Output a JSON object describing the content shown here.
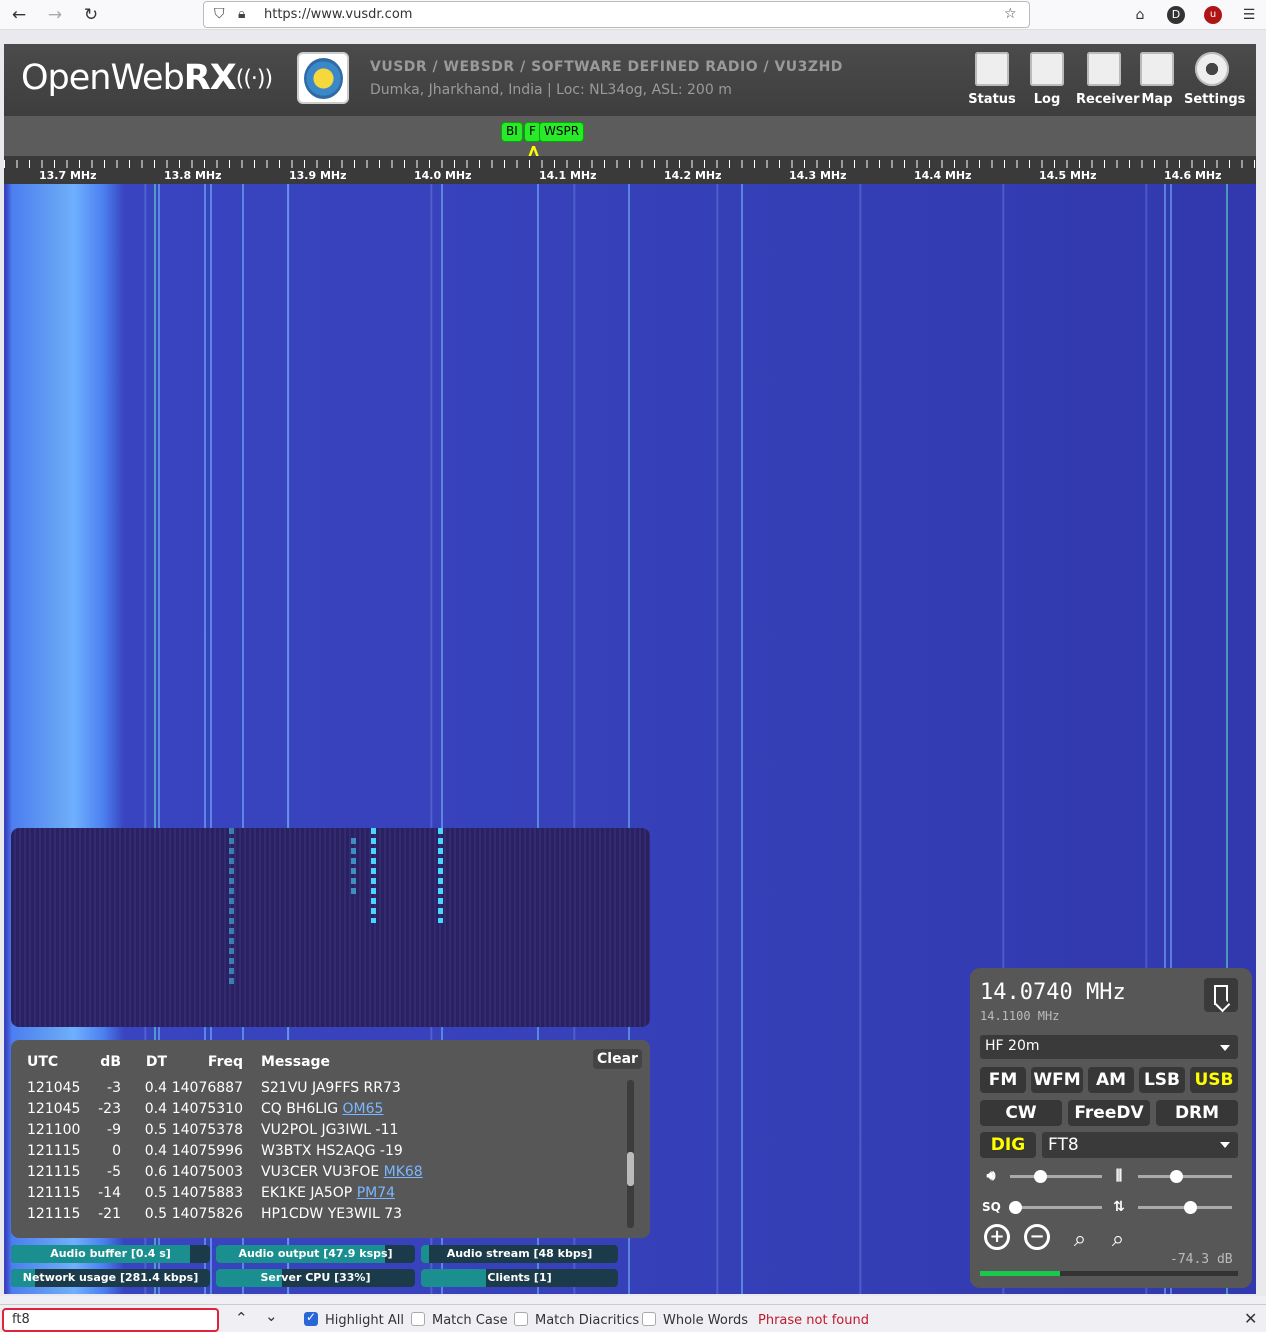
{
  "browser": {
    "url": "https://www.vusdr.com",
    "profile_initial": "D"
  },
  "header": {
    "logo_open": "OpenWeb",
    "logo_rx": "RX",
    "title": "VUSDR / WEBSDR / SOFTWARE DEFINED RADIO / VU3ZHD",
    "description": "Dumka, Jharkhand, India | Loc: NL34og, ASL: 200 m",
    "buttons": [
      "Status",
      "Log",
      "Receiver",
      "Map",
      "Settings"
    ]
  },
  "bookmarks": [
    "BI",
    "F",
    "WSPR"
  ],
  "scale": [
    "13.7 MHz",
    "13.8 MHz",
    "13.9 MHz",
    "14.0 MHz",
    "14.1 MHz",
    "14.2 MHz",
    "14.3 MHz",
    "14.4 MHz",
    "14.5 MHz",
    "14.6 MHz"
  ],
  "decoder": {
    "columns": {
      "utc": "UTC",
      "db": "dB",
      "dt": "DT",
      "freq": "Freq",
      "message": "Message"
    },
    "clear_label": "Clear",
    "rows": [
      {
        "utc": "121045",
        "db": "-3",
        "dt": "0.4",
        "freq": "14076887",
        "message": "S21VU JA9FFS RR73",
        "locator": ""
      },
      {
        "utc": "121045",
        "db": "-23",
        "dt": "0.4",
        "freq": "14075310",
        "message": "CQ BH6LIG",
        "locator": "OM65"
      },
      {
        "utc": "121100",
        "db": "-9",
        "dt": "0.5",
        "freq": "14075378",
        "message": "VU2POL JG3IWL -11",
        "locator": ""
      },
      {
        "utc": "121115",
        "db": "0",
        "dt": "0.4",
        "freq": "14075996",
        "message": "W3BTX HS2AQG -19",
        "locator": ""
      },
      {
        "utc": "121115",
        "db": "-5",
        "dt": "0.6",
        "freq": "14075003",
        "message": "VU3CER VU3FOE",
        "locator": "MK68"
      },
      {
        "utc": "121115",
        "db": "-14",
        "dt": "0.5",
        "freq": "14075883",
        "message": "EK1KE JA5OP",
        "locator": "PM74"
      },
      {
        "utc": "121115",
        "db": "-21",
        "dt": "0.5",
        "freq": "14075826",
        "message": "HP1CDW YE3WIL 73",
        "locator": ""
      }
    ]
  },
  "status_bars": {
    "audio_buffer": {
      "label": "Audio buffer [0.4 s]",
      "level": 0.9
    },
    "audio_output": {
      "label": "Audio output [47.9 ksps]",
      "level": 0.85
    },
    "audio_stream": {
      "label": "Audio stream [48 kbps]",
      "level": 0.04
    },
    "network_usage": {
      "label": "Network usage [281.4 kbps]",
      "level": 0.12
    },
    "server_cpu": {
      "label": "Server CPU [33%]",
      "level": 0.33
    },
    "clients": {
      "label": "Clients [1]",
      "level": 0.33
    }
  },
  "receiver": {
    "frequency": "14.0740 MHz",
    "offset_frequency": "14.1100 MHz",
    "band": "HF 20m",
    "modes_row1": [
      "FM",
      "WFM",
      "AM",
      "LSB",
      "USB"
    ],
    "modes_row2": [
      "CW",
      "FreeDV",
      "DRM"
    ],
    "active_mode": "USB",
    "dig_label": "DIG",
    "dig_mode": "FT8",
    "volume_level": 0.33,
    "squelch_level": 0.05,
    "nr_level": 0.4,
    "agc_level": 0.55,
    "smeter_db": "-74.3 dB",
    "smeter_level": 0.31
  },
  "findbar": {
    "query": "ft8",
    "highlight_all": "Highlight All",
    "match_case": "Match Case",
    "match_diacritics": "Match Diacritics",
    "whole_words": "Whole Words",
    "result": "Phrase not found"
  }
}
